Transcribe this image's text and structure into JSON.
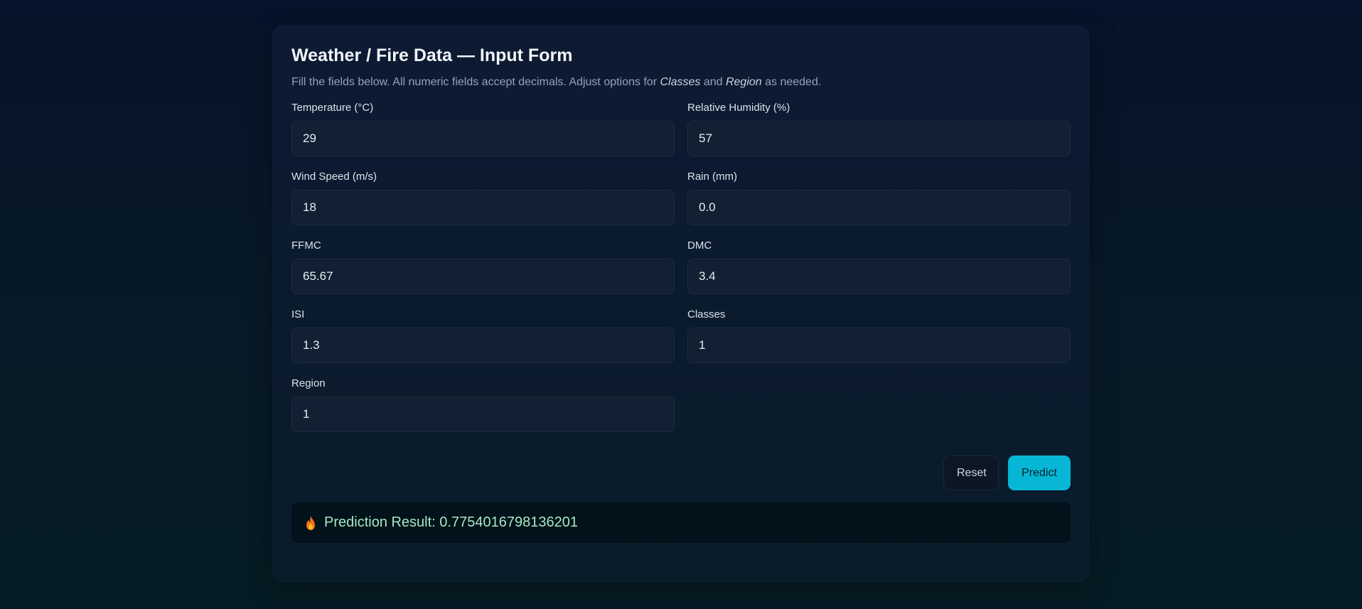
{
  "form": {
    "title": "Weather / Fire Data — Input Form",
    "subtitle_prefix": "Fill the fields below. All numeric fields accept decimals. Adjust options for ",
    "subtitle_em1": "Classes",
    "subtitle_mid": " and ",
    "subtitle_em2": "Region",
    "subtitle_suffix": " as needed."
  },
  "fields": {
    "temperature": {
      "label": "Temperature (°C)",
      "value": "29"
    },
    "humidity": {
      "label": "Relative Humidity (%)",
      "value": "57"
    },
    "wind_speed": {
      "label": "Wind Speed (m/s)",
      "value": "18"
    },
    "rain": {
      "label": "Rain (mm)",
      "value": "0.0"
    },
    "ffmc": {
      "label": "FFMC",
      "value": "65.67"
    },
    "dmc": {
      "label": "DMC",
      "value": "3.4"
    },
    "isi": {
      "label": "ISI",
      "value": "1.3"
    },
    "classes": {
      "label": "Classes",
      "value": "1"
    },
    "region": {
      "label": "Region",
      "value": "1"
    }
  },
  "actions": {
    "reset_label": "Reset",
    "predict_label": "Predict"
  },
  "result": {
    "icon": "fire-icon",
    "text": "Prediction Result: 0.7754016798136201"
  },
  "colors": {
    "accent": "#06b6d4",
    "result_text": "#a7e8c4"
  }
}
